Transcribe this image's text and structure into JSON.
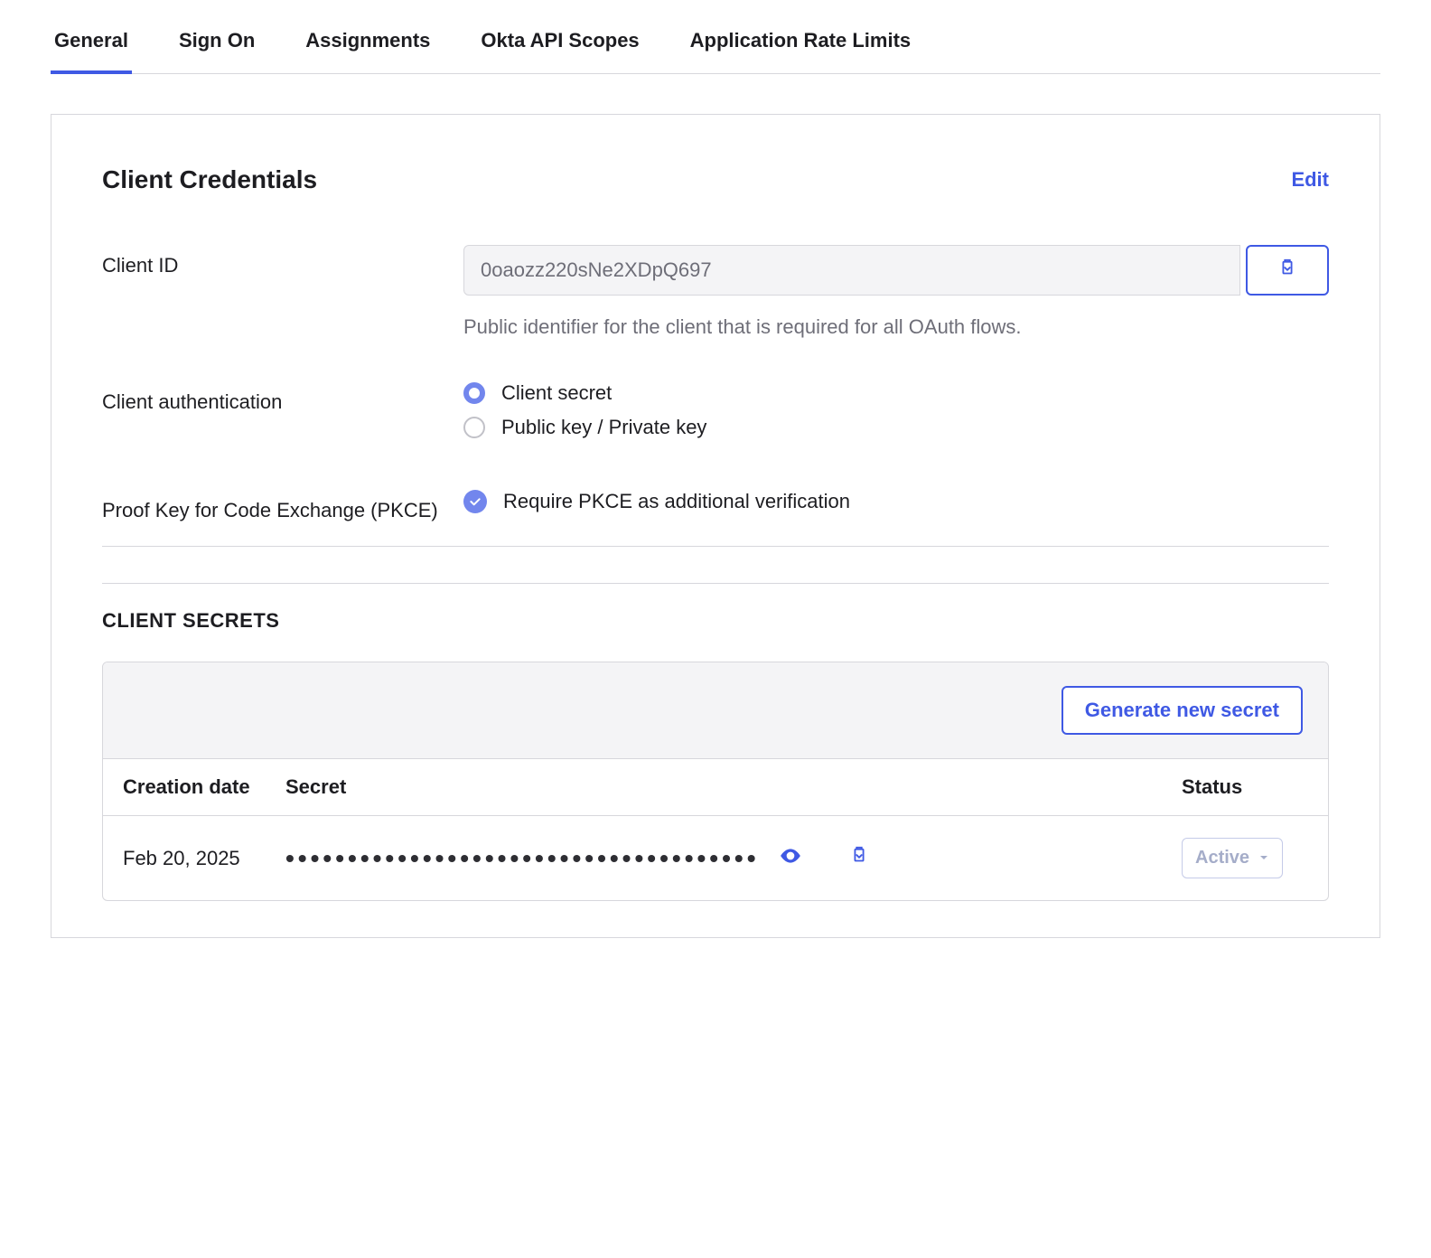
{
  "tabs": [
    {
      "label": "General",
      "active": true
    },
    {
      "label": "Sign On",
      "active": false
    },
    {
      "label": "Assignments",
      "active": false
    },
    {
      "label": "Okta API Scopes",
      "active": false
    },
    {
      "label": "Application Rate Limits",
      "active": false
    }
  ],
  "credentials": {
    "title": "Client Credentials",
    "edit_label": "Edit",
    "client_id": {
      "label": "Client ID",
      "value": "0oaozz220sNe2XDpQ697",
      "help": "Public identifier for the client that is required for all OAuth flows."
    },
    "auth": {
      "label": "Client authentication",
      "options": [
        {
          "label": "Client secret",
          "selected": true
        },
        {
          "label": "Public key / Private key",
          "selected": false
        }
      ]
    },
    "pkce": {
      "label": "Proof Key for Code Exchange (PKCE)",
      "checkbox_label": "Require PKCE as additional verification",
      "checked": true
    }
  },
  "secrets": {
    "section_title": "CLIENT SECRETS",
    "generate_label": "Generate new secret",
    "columns": {
      "date": "Creation date",
      "secret": "Secret",
      "status": "Status"
    },
    "rows": [
      {
        "date": "Feb 20, 2025",
        "masked": "••••••••••••••••••••••••••••••••••••••",
        "status": "Active"
      }
    ]
  },
  "colors": {
    "primary": "#3f59e4",
    "primary_light": "#7286ed"
  }
}
